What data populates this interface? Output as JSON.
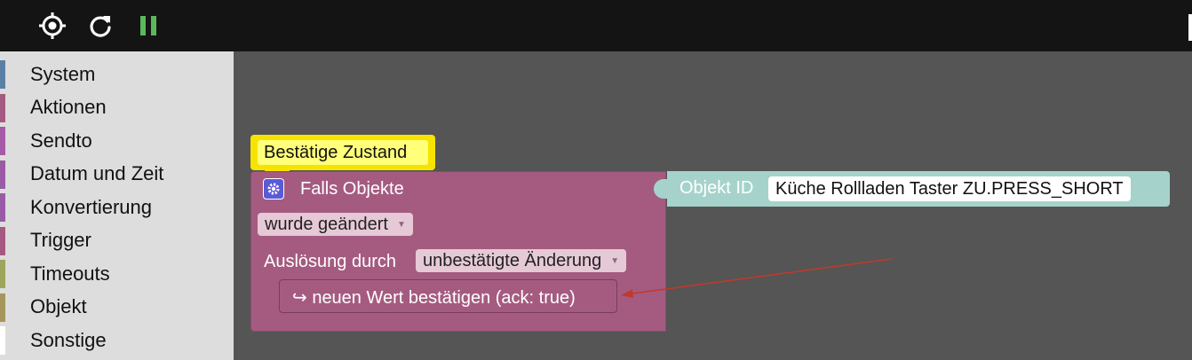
{
  "toolbar": {
    "icons": [
      "target-icon",
      "refresh-icon",
      "pause-icon"
    ],
    "pause_color": "#5cb85c"
  },
  "sidebar": {
    "categories": [
      {
        "label": "System",
        "color": "#5b80a5"
      },
      {
        "label": "Aktionen",
        "color": "#a55b80"
      },
      {
        "label": "Sendto",
        "color": "#a55ba5"
      },
      {
        "label": "Datum und Zeit",
        "color": "#9a5ba5"
      },
      {
        "label": "Konvertierung",
        "color": "#9a5ba5"
      },
      {
        "label": "Trigger",
        "color": "#a55b80"
      },
      {
        "label": "Timeouts",
        "color": "#9fa55b"
      },
      {
        "label": "Objekt",
        "color": "#a5965b"
      },
      {
        "label": "Sonstige",
        "color": "#ffffff"
      }
    ]
  },
  "workspace": {
    "comment": "Bestätige Zustand",
    "trigger_block": {
      "title": "Falls Objekte",
      "event_dropdown": "wurde geändert",
      "trigger_label": "Auslösung durch",
      "trigger_dropdown": "unbestätigte Änderung",
      "color": "#a55b80"
    },
    "object_block": {
      "label": "Objekt ID",
      "value": "Küche Rollladen Taster ZU.PRESS_SHORT",
      "color": "#a5d3cb"
    },
    "statement_block": {
      "text": "↪ neuen Wert bestätigen (ack: true)"
    },
    "annotation_arrow_color": "#c0392b"
  }
}
